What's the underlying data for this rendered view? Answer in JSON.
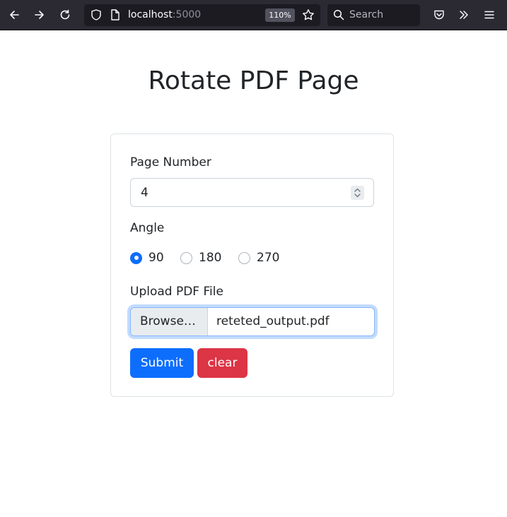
{
  "browser": {
    "url_host": "localhost",
    "url_port": ":5000",
    "zoom": "110%",
    "search_placeholder": "Search",
    "icons": [
      "back-icon",
      "forward-icon",
      "reload-icon",
      "shield-icon",
      "page-icon",
      "bookmark-star-icon",
      "search-icon",
      "pocket-icon",
      "overflow-chevrons-icon",
      "menu-icon"
    ]
  },
  "page": {
    "title": "Rotate PDF Page"
  },
  "form": {
    "page_number_label": "Page Number",
    "page_number_value": "4",
    "angle_label": "Angle",
    "angles": [
      {
        "label": "90",
        "checked": true
      },
      {
        "label": "180",
        "checked": false
      },
      {
        "label": "270",
        "checked": false
      }
    ],
    "upload_label": "Upload PDF File",
    "browse_label": "Browse…",
    "file_name": "reteted_output.pdf",
    "submit_label": "Submit",
    "clear_label": "clear"
  },
  "colors": {
    "primary": "#0d6efd",
    "danger": "#dc3545",
    "toolbar": "#2b2a33"
  }
}
